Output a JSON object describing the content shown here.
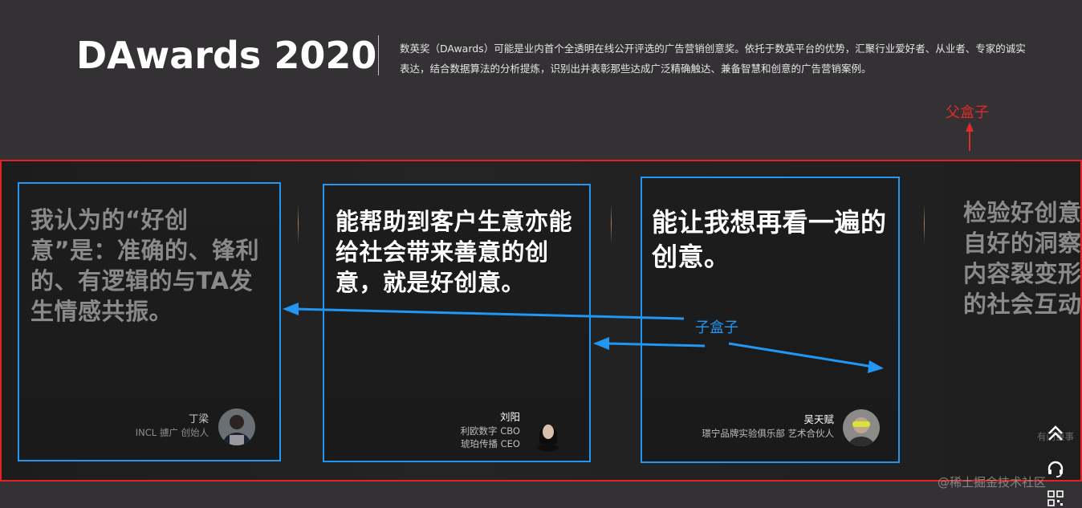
{
  "header": {
    "title": "DAwards 2020",
    "description": "数英奖（DAwards）可能是业内首个全透明在线公开评选的广告营销创意奖。依托于数英平台的优势，汇聚行业爱好者、从业者、专家的诚实表达，结合数据算法的分析提炼，识别出并表彰那些达成广泛精确触达、兼备智慧和创意的广告营销案例。"
  },
  "annotations": {
    "parent_label": "父盒子",
    "child_label": "子盒子"
  },
  "cards": [
    {
      "quote": "我认为的“好创意”是：准确的、锋利的、有逻辑的与TA发生情感共振。",
      "name": "丁梁",
      "title_lines": [
        "INCL 擄广 创始人"
      ],
      "avatar_icon": "person-avatar-icon"
    },
    {
      "quote": "能帮助到客户生意亦能给社会带来善意的创意，就是好创意。",
      "name": "刘阳",
      "title_lines": [
        "利欧数字 CBO",
        "琥珀传播 CEO"
      ],
      "avatar_icon": "person-avatar-icon"
    },
    {
      "quote": "能让我想再看一遍的创意。",
      "name": "吴天赋",
      "title_lines": [
        "璟宁品牌实验俱乐部 艺术合伙人"
      ],
      "avatar_icon": "person-avatar-icon"
    },
    {
      "quote": "检验好创意的标准：源自好的洞察；呈现好的内容裂变形态；获得好的社会互动嫁接。",
      "name": "",
      "title_lines": [
        "有门董事"
      ],
      "avatar_icon": "person-avatar-icon"
    }
  ],
  "float_tools": {
    "top_icon": "double-chevron-up-icon",
    "support_icon": "headset-icon",
    "qr_icon": "qr-code-icon"
  },
  "watermark": "@稀土掘金技术社区",
  "colors": {
    "background": "#333133",
    "parent_box_border": "#e42222",
    "child_box_border": "#2196f3",
    "separator": "#a8865a"
  }
}
